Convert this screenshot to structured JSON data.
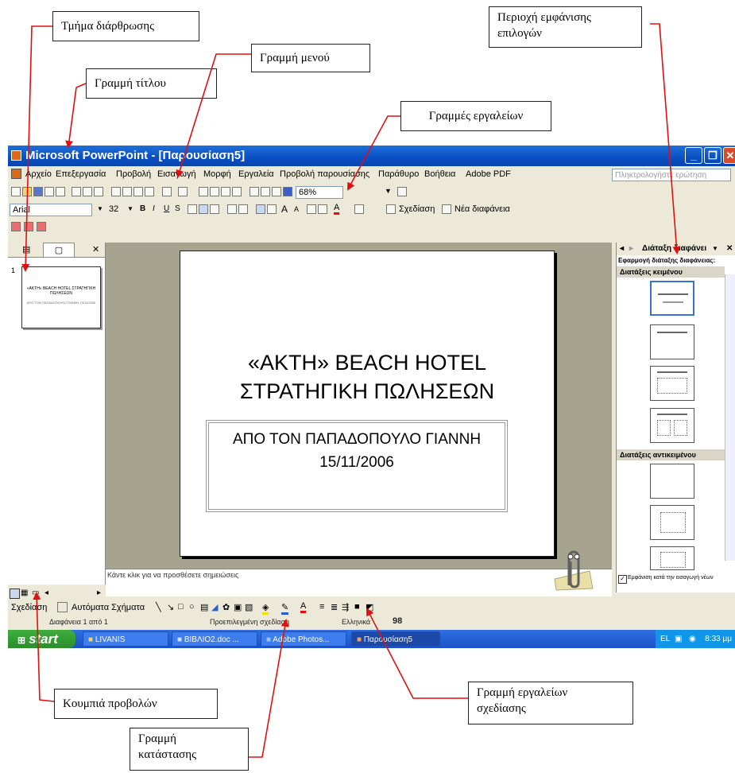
{
  "callouts": {
    "section": "Τμήμα διάρθρωσης",
    "menu_bar": "Γραμμή μενού",
    "title_bar": "Γραμμή τίτλου",
    "options_area_line1": "Περιοχή εμφάνισης",
    "options_area_line2": "επιλογών",
    "toolbars": "Γραμμές εργαλείων",
    "view_buttons": "Κουμπιά προβολών",
    "drawing_toolbar_line1": "Γραμμή  εργαλείων",
    "drawing_toolbar_line2": "σχεδίασης",
    "status_bar_line1": "Γραμμή",
    "status_bar_line2": "κατάστασης"
  },
  "window": {
    "title": "Microsoft PowerPoint - [Παρουσίαση5]",
    "menu": [
      "Αρχείο",
      "Επεξεργασία",
      "Προβολή",
      "Εισαγωγή",
      "Μορφή",
      "Εργαλεία",
      "Προβολή παρουσίασης",
      "Παράθυρο",
      "Βοήθεια",
      "Adobe PDF"
    ],
    "help_placeholder": "Πληκτρολογήστε ερώτηση",
    "zoom": "68%",
    "font_name": "Arial",
    "font_size": "32",
    "design_label": "Σχεδίαση",
    "new_slide_label": "Νέα διαφάνεια"
  },
  "slide": {
    "title_line1": "«ΑΚΤΗ» BEACH HOTEL",
    "title_line2": "ΣΤΡΑΤΗΓΙΚΗ ΠΩΛΗΣΕΩΝ",
    "subtitle_line1": "ΑΠΟ ΤΟΝ ΠΑΠΑΔΟΠΟΥΛΟ ΓΙΑΝΝΗ",
    "subtitle_line2": "15/11/2006",
    "thumb_number": "1",
    "thumb_title": "«ΑΚΤΗ» BEACH HOTEL ΣΤΡΑΤΗΓΙΚΗ ΠΩΛΗΣΕΩΝ",
    "thumb_sub": "ΑΠΟ ΤΟΝ ΠΑΠΑΔΟΠΟΥΛΟ ΓΙΑΝΝΗ 15/11/2006"
  },
  "notes_placeholder": "Κάντε κλικ για να προσθέσετε σημειώσεις",
  "task_pane": {
    "title": "Διάταξη διαφάνει",
    "apply_label": "Εφαρμογή διάταξης διαφάνειας:",
    "text_layouts": "Διατάξεις κειμένου",
    "content_layouts": "Διατάξεις αντικειμένου",
    "show_on_insert": "Εμφάνιση κατά την εισαγωγή νέων"
  },
  "drawing_bar": {
    "draw_label": "Σχεδίαση",
    "autoshapes_label": "Αυτόματα Σχήματα"
  },
  "status_bar": {
    "slide_pos": "Διαφάνεια 1 από 1",
    "design": "Προεπιλεγμένη σχεδίαση",
    "language": "Ελληνικά"
  },
  "taskbar": {
    "start": "start",
    "items": [
      "LIVANIS",
      "BIBΛΙΟ2.doc ...",
      "Adobe Photos...",
      "Παρουσίαση5"
    ],
    "clock": "8:33 μμ"
  },
  "colors": {
    "title_bar": "#0a4fc3",
    "taskbar": "#1a52c8",
    "slide_area": "#a6a38f",
    "arrow": "#e01010"
  }
}
